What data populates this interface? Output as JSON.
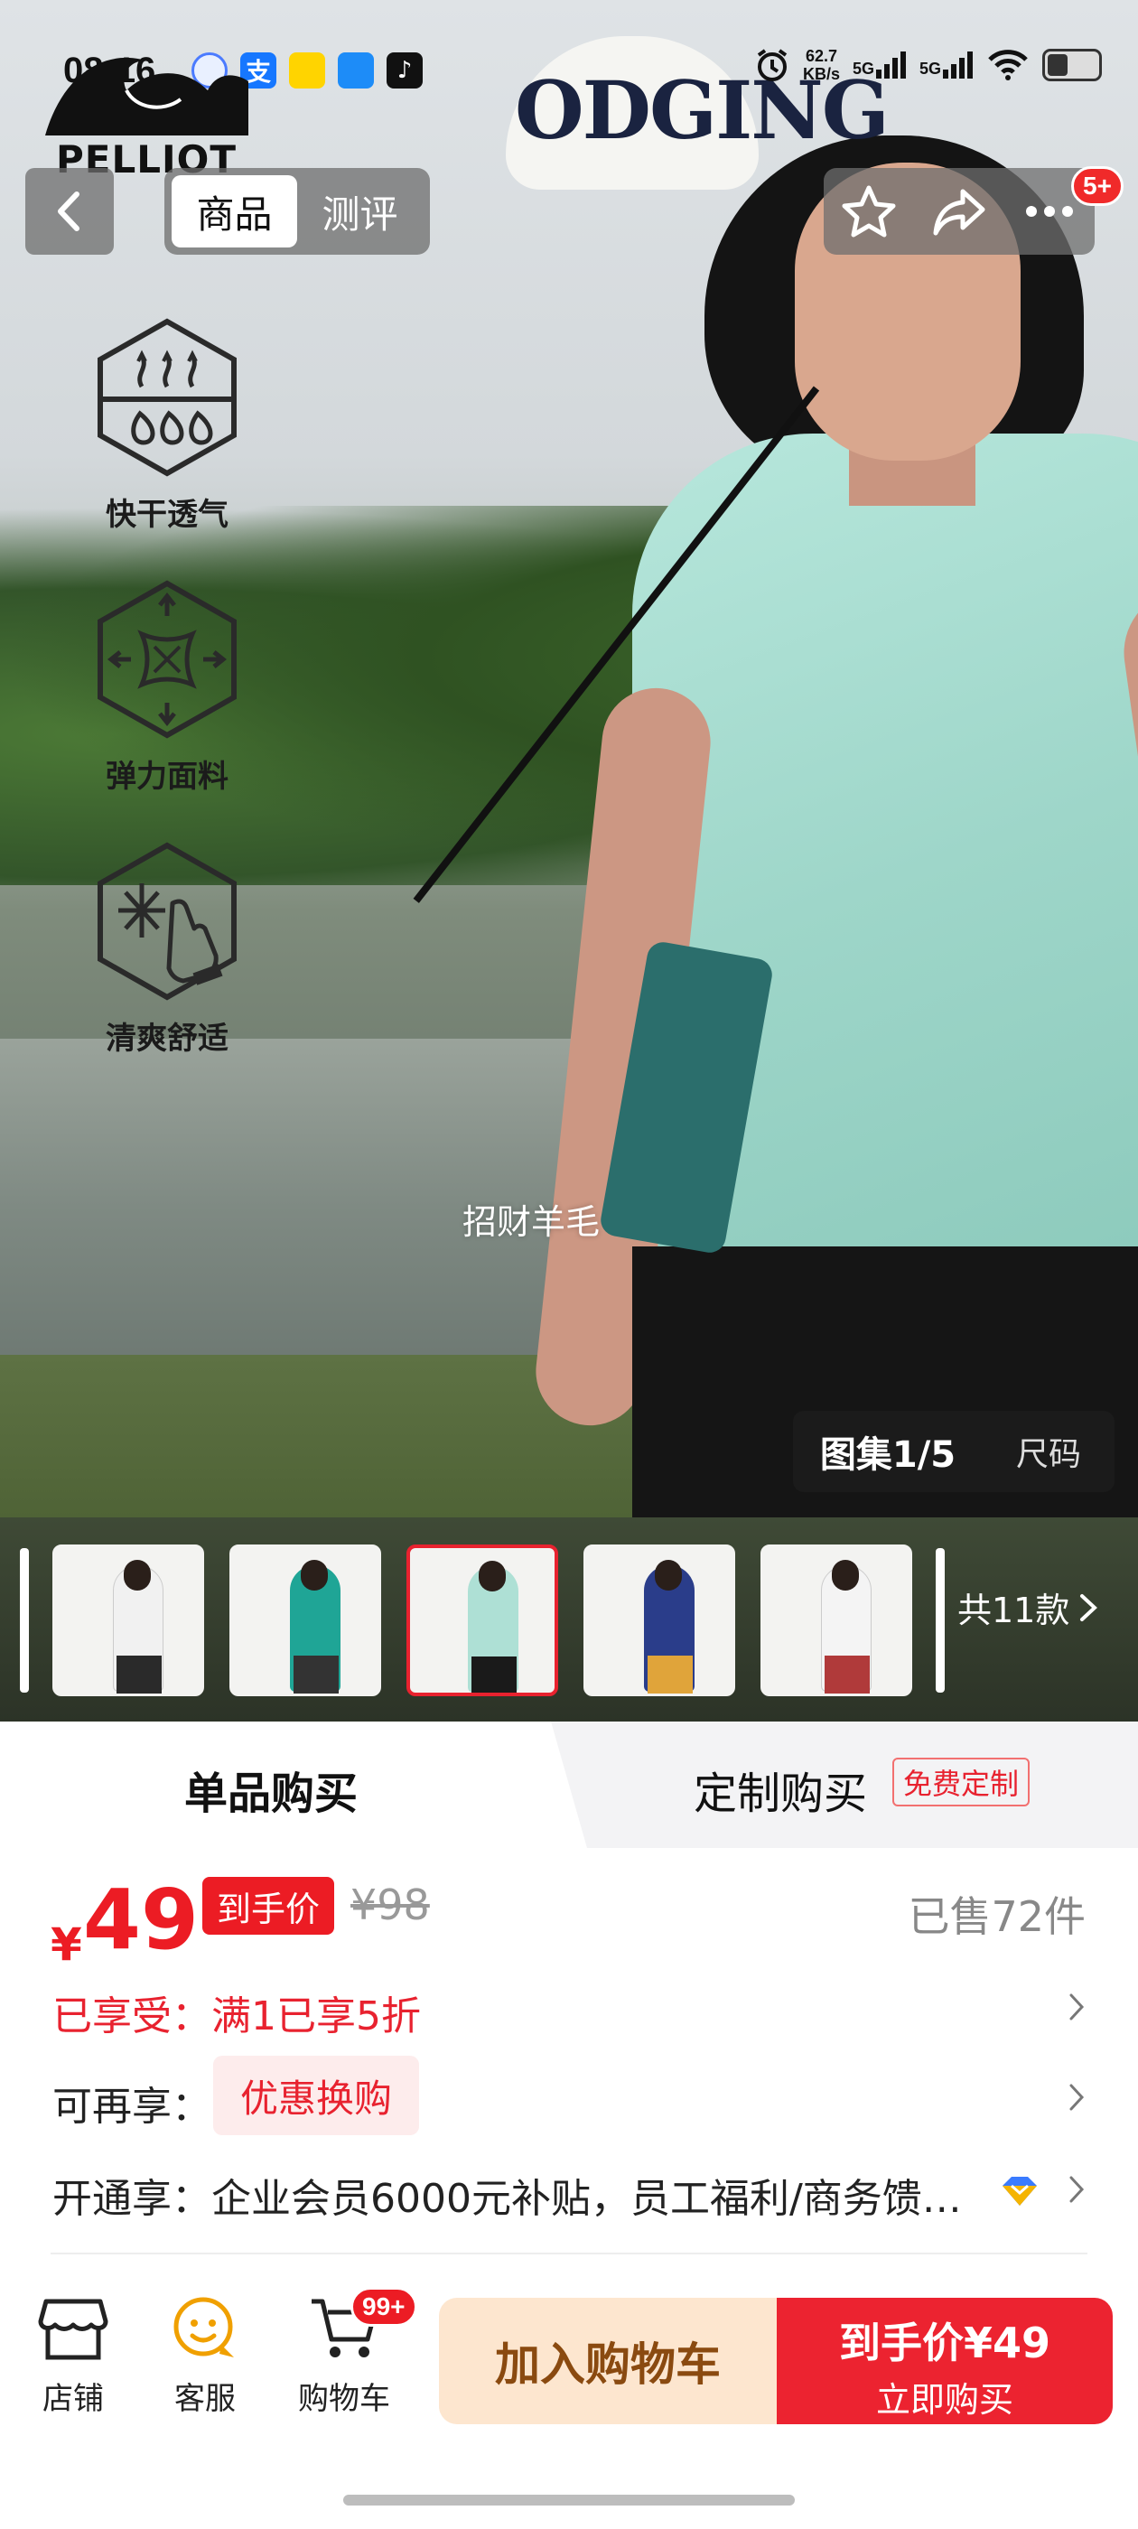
{
  "status_bar": {
    "time": "08:16",
    "net_speed_value": "62.7",
    "net_speed_unit": "KB/s",
    "signal_1": "5G",
    "signal_2": "5G"
  },
  "brand": {
    "name": "PELLIOT"
  },
  "header": {
    "tabs": [
      {
        "label": "商品",
        "active": true
      },
      {
        "label": "测评",
        "active": false
      }
    ],
    "badge": "5+"
  },
  "hero": {
    "cap_text": "ODGING",
    "features": [
      {
        "label": "快干透气",
        "icon": "quick-dry-icon"
      },
      {
        "label": "弹力面料",
        "icon": "stretch-fabric-icon"
      },
      {
        "label": "清爽舒适",
        "icon": "cool-comfort-icon"
      }
    ],
    "watermark": "招财羊毛",
    "gallery_label": "图集1/5",
    "size_label": "尺码"
  },
  "variants": {
    "items": [
      {
        "color": "#f1f1f1",
        "legs": "#2a2a2a",
        "selected": false
      },
      {
        "color": "#1fa596",
        "legs": "#333333",
        "selected": false
      },
      {
        "color": "#aee0d5",
        "legs": "#1a1a1a",
        "selected": true
      },
      {
        "color": "#2a3d8a",
        "legs": "#e0a43a",
        "selected": false
      },
      {
        "color": "#f4f4f4",
        "legs": "#b03a3a",
        "selected": false
      }
    ],
    "more_label": "共11款"
  },
  "purchase_tabs": {
    "single": "单品购买",
    "custom": "定制购买",
    "custom_badge": "免费定制"
  },
  "price": {
    "currency": "¥",
    "value": "49",
    "final_label": "到手价",
    "original": "¥98",
    "sold": "已售72件"
  },
  "info_rows": {
    "enjoyed": "已享受：满1已享5折",
    "more_label": "可再享：",
    "more_pill": "优惠换购",
    "open": "开通享：企业会员6000元补贴，员工福利/商务馈…"
  },
  "bottom_bar": {
    "store": "店铺",
    "service": "客服",
    "cart": "购物车",
    "cart_badge": "99+",
    "add_to_cart": "加入购物车",
    "buy_top": "到手价¥49",
    "buy_bottom": "立即购买"
  },
  "colors": {
    "accent_red": "#ec1c24",
    "cart_button_bg": "#fde6cf",
    "cart_button_text": "#8a4a10"
  }
}
